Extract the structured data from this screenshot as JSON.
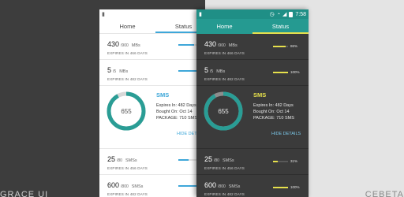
{
  "captions": {
    "left": "GRACE UI",
    "right": "CEBETA"
  },
  "light_phone": {
    "tabs": [
      {
        "label": "Home"
      },
      {
        "label": "Status"
      }
    ],
    "usage_top": [
      {
        "value": "430",
        "total": "/900",
        "unit": "MBs",
        "expires": "EXPIRES IN 466 DAYS",
        "fill": 0.48
      },
      {
        "value": "5",
        "total": "/5",
        "unit": "MBs",
        "expires": "EXPIRES IN 482 DAYS",
        "fill": 1.0
      }
    ],
    "sms": {
      "donut_value": "655",
      "title": "SMS",
      "expires_line": "Expires In: 482 Days",
      "bought_line": "Bought On: Oct 14",
      "package_line": "PACKAGE: 710 SMS",
      "hide_label": "HIDE DETAILS",
      "fill": 0.92
    },
    "usage_bottom": [
      {
        "value": "25",
        "total": "/80",
        "unit": "SMSs",
        "expires": "EXPIRES IN 456 DAYS",
        "fill": 0.31
      },
      {
        "value": "600",
        "total": "/800",
        "unit": "SMSs",
        "expires": "EXPIRES IN 482 DAYS",
        "fill": 0.75
      }
    ]
  },
  "dark_phone": {
    "status_time": "7:58",
    "tabs": [
      {
        "label": "Home"
      },
      {
        "label": "Status"
      }
    ],
    "usage_top": [
      {
        "value": "430",
        "total": "/900",
        "unit": "MBs",
        "expires": "EXPIRES IN 466 DAYS",
        "fill": 0.86,
        "pct_label": "86%"
      },
      {
        "value": "5",
        "total": "/5",
        "unit": "MBs",
        "expires": "EXPIRES IN 482 DAYS",
        "fill": 1.0,
        "pct_label": "100%"
      }
    ],
    "sms": {
      "donut_value": "655",
      "title": "SMS",
      "expires_line": "Expires In: 482 Days",
      "bought_line": "Bought On: Oct 14",
      "package_line": "PACKAGE: 710 SMS",
      "hide_label": "HIDE DETAILS",
      "fill": 0.92
    },
    "usage_bottom": [
      {
        "value": "25",
        "total": "/80",
        "unit": "SMSs",
        "expires": "EXPIRES IN 456 DAYS",
        "fill": 0.31,
        "pct_label": "31%"
      },
      {
        "value": "600",
        "total": "/800",
        "unit": "SMSs",
        "expires": "EXPIRES IN 482 DAYS",
        "fill": 1.0,
        "pct_label": "100%"
      }
    ]
  },
  "colors": {
    "light_accent": "#3ea7d9",
    "dark_accent": "#e6e04c",
    "teal": "#259a91",
    "donut_ring": "#2a9d95"
  }
}
